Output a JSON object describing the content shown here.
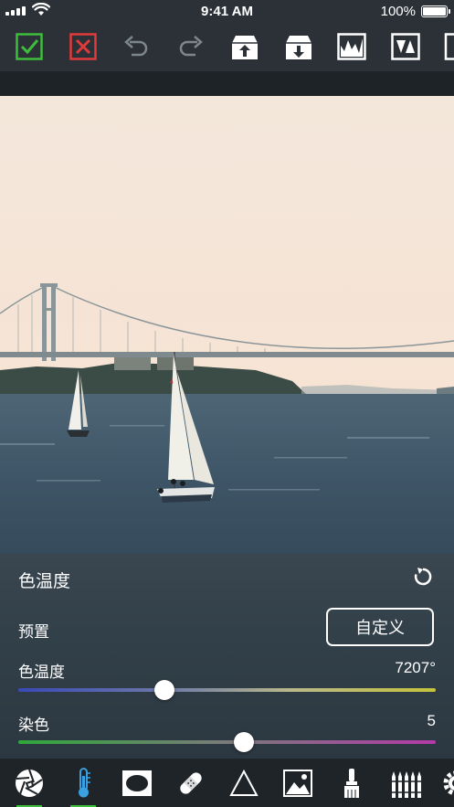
{
  "status_bar": {
    "time": "9:41 AM",
    "battery": "100%"
  },
  "toolbar": {
    "buttons": [
      "confirm-icon",
      "cancel-icon",
      "undo-icon",
      "redo-icon",
      "import-icon",
      "export-icon",
      "histogram-icon",
      "compare-icon"
    ],
    "confirm_color": "#3fbd3d",
    "cancel_color": "#e03a3a"
  },
  "adjust_panel": {
    "title": "色温度",
    "preset_label": "预置",
    "preset_value": "自定义",
    "temperature": {
      "label": "色温度",
      "value": "7207°",
      "level": 0.35
    },
    "tint": {
      "label": "染色",
      "value": "5",
      "level": 0.54
    }
  },
  "bottom_tools": {
    "items": [
      "aperture-icon",
      "thermometer-icon",
      "vignette-icon",
      "bandage-icon",
      "triangle-icon",
      "landscape-icon",
      "brush-icon",
      "crayons-icon",
      "settings-icon"
    ],
    "active": [
      "aperture-icon",
      "thermometer-icon"
    ],
    "accent": "#3fbd3d"
  }
}
